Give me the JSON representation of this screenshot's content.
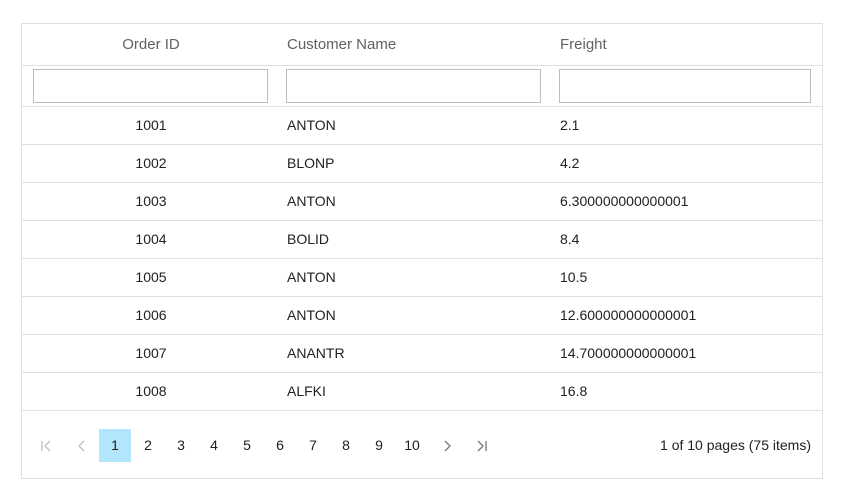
{
  "columns": {
    "order_id": "Order ID",
    "customer_name": "Customer Name",
    "freight": "Freight"
  },
  "filters": {
    "order_id": "",
    "customer_name": "",
    "freight": ""
  },
  "rows": [
    {
      "order_id": "1001",
      "customer_name": "ANTON",
      "freight": "2.1"
    },
    {
      "order_id": "1002",
      "customer_name": "BLONP",
      "freight": "4.2"
    },
    {
      "order_id": "1003",
      "customer_name": "ANTON",
      "freight": "6.300000000000001"
    },
    {
      "order_id": "1004",
      "customer_name": "BOLID",
      "freight": "8.4"
    },
    {
      "order_id": "1005",
      "customer_name": "ANTON",
      "freight": "10.5"
    },
    {
      "order_id": "1006",
      "customer_name": "ANTON",
      "freight": "12.600000000000001"
    },
    {
      "order_id": "1007",
      "customer_name": "ANANTR",
      "freight": "14.700000000000001"
    },
    {
      "order_id": "1008",
      "customer_name": "ALFKI",
      "freight": "16.8"
    }
  ],
  "pager": {
    "pages": [
      "1",
      "2",
      "3",
      "4",
      "5",
      "6",
      "7",
      "8",
      "9",
      "10"
    ],
    "current_page": "1",
    "info": "1 of 10 pages (75 items)",
    "icons": {
      "first": "first-page-icon",
      "prev": "previous-page-icon",
      "next": "next-page-icon",
      "last": "last-page-icon"
    }
  },
  "colors": {
    "active_page": "#b3e5fc",
    "border": "#e0e0e0",
    "disabled_nav": "#bdbdbd",
    "enabled_nav": "#757575"
  }
}
